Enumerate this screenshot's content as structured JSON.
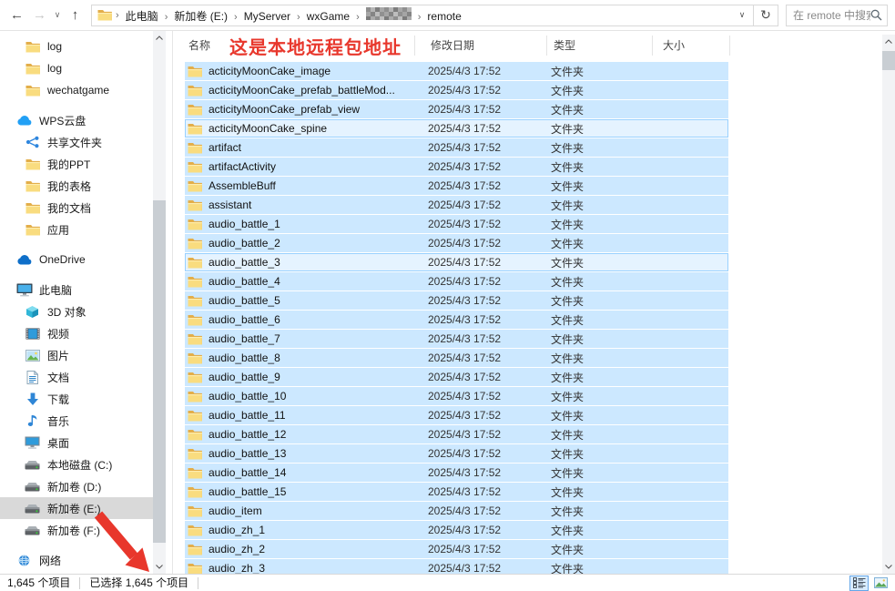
{
  "colors": {
    "selection_blue": "#cce8ff",
    "focus_row_bg": "#e5f3ff",
    "focus_row_border": "#99d1ff",
    "sidebar_selected": "#d9d9d9",
    "annotation_red": "#e8372c",
    "folder_yellow": "#f9dc7f",
    "accent_blue": "#0078d7"
  },
  "toolbar": {
    "back_glyph": "←",
    "forward_glyph": "→",
    "history_chevron_glyph": "∨",
    "up_glyph": "↑",
    "address_chevron_glyph": "∨",
    "refresh_glyph": "↻"
  },
  "address_bar": {
    "crumbs": [
      {
        "label": "此电脑",
        "redacted": false
      },
      {
        "label": "新加卷 (E:)",
        "redacted": false
      },
      {
        "label": "MyServer",
        "redacted": false
      },
      {
        "label": "wxGame",
        "redacted": false
      },
      {
        "label": "",
        "redacted": true
      },
      {
        "label": "remote",
        "redacted": false
      }
    ],
    "separator_glyph": "›"
  },
  "search": {
    "placeholder": "在 remote 中搜索"
  },
  "annotation": {
    "text": "这是本地远程包地址"
  },
  "sidebar": {
    "items": [
      {
        "label": "log",
        "icon": "folder",
        "level": 1,
        "gap_before": false,
        "selected": false
      },
      {
        "label": "log",
        "icon": "folder",
        "level": 1,
        "gap_before": false,
        "selected": false
      },
      {
        "label": "wechatgame",
        "icon": "folder",
        "level": 1,
        "gap_before": false,
        "selected": false
      },
      {
        "label": "WPS云盘",
        "icon": "wps-cloud",
        "level": 0,
        "gap_before": true,
        "selected": false
      },
      {
        "label": "共享文件夹",
        "icon": "share",
        "level": 1,
        "gap_before": false,
        "selected": false
      },
      {
        "label": "我的PPT",
        "icon": "folder",
        "level": 1,
        "gap_before": false,
        "selected": false
      },
      {
        "label": "我的表格",
        "icon": "folder",
        "level": 1,
        "gap_before": false,
        "selected": false
      },
      {
        "label": "我的文档",
        "icon": "folder",
        "level": 1,
        "gap_before": false,
        "selected": false
      },
      {
        "label": "应用",
        "icon": "folder",
        "level": 1,
        "gap_before": false,
        "selected": false
      },
      {
        "label": "OneDrive",
        "icon": "onedrive-cloud",
        "level": 0,
        "gap_before": true,
        "selected": false
      },
      {
        "label": "此电脑",
        "icon": "this-pc",
        "level": 0,
        "gap_before": true,
        "selected": false
      },
      {
        "label": "3D 对象",
        "icon": "3d-object",
        "level": 1,
        "gap_before": false,
        "selected": false
      },
      {
        "label": "视频",
        "icon": "video",
        "level": 1,
        "gap_before": false,
        "selected": false
      },
      {
        "label": "图片",
        "icon": "pictures",
        "level": 1,
        "gap_before": false,
        "selected": false
      },
      {
        "label": "文档",
        "icon": "documents",
        "level": 1,
        "gap_before": false,
        "selected": false
      },
      {
        "label": "下载",
        "icon": "downloads",
        "level": 1,
        "gap_before": false,
        "selected": false
      },
      {
        "label": "音乐",
        "icon": "music",
        "level": 1,
        "gap_before": false,
        "selected": false
      },
      {
        "label": "桌面",
        "icon": "desktop",
        "level": 1,
        "gap_before": false,
        "selected": false
      },
      {
        "label": "本地磁盘 (C:)",
        "icon": "drive",
        "level": 1,
        "gap_before": false,
        "selected": false
      },
      {
        "label": "新加卷 (D:)",
        "icon": "drive",
        "level": 1,
        "gap_before": false,
        "selected": false
      },
      {
        "label": "新加卷 (E:)",
        "icon": "drive",
        "level": 1,
        "gap_before": false,
        "selected": true
      },
      {
        "label": "新加卷 (F:)",
        "icon": "drive",
        "level": 1,
        "gap_before": false,
        "selected": false
      },
      {
        "label": "网络",
        "icon": "network",
        "level": 0,
        "gap_before": true,
        "selected": false
      }
    ]
  },
  "file_list": {
    "columns": [
      "名称",
      "修改日期",
      "类型",
      "大小"
    ],
    "rows": [
      {
        "name": "acticityMoonCake_image",
        "date": "2025/4/3 17:52",
        "type": "文件夹",
        "size": "",
        "focused": false
      },
      {
        "name": "acticityMoonCake_prefab_battleMod...",
        "date": "2025/4/3 17:52",
        "type": "文件夹",
        "size": "",
        "focused": false
      },
      {
        "name": "acticityMoonCake_prefab_view",
        "date": "2025/4/3 17:52",
        "type": "文件夹",
        "size": "",
        "focused": false
      },
      {
        "name": "acticityMoonCake_spine",
        "date": "2025/4/3 17:52",
        "type": "文件夹",
        "size": "",
        "focused": true
      },
      {
        "name": "artifact",
        "date": "2025/4/3 17:52",
        "type": "文件夹",
        "size": "",
        "focused": false
      },
      {
        "name": "artifactActivity",
        "date": "2025/4/3 17:52",
        "type": "文件夹",
        "size": "",
        "focused": false
      },
      {
        "name": "AssembleBuff",
        "date": "2025/4/3 17:52",
        "type": "文件夹",
        "size": "",
        "focused": false
      },
      {
        "name": "assistant",
        "date": "2025/4/3 17:52",
        "type": "文件夹",
        "size": "",
        "focused": false
      },
      {
        "name": "audio_battle_1",
        "date": "2025/4/3 17:52",
        "type": "文件夹",
        "size": "",
        "focused": false
      },
      {
        "name": "audio_battle_2",
        "date": "2025/4/3 17:52",
        "type": "文件夹",
        "size": "",
        "focused": false
      },
      {
        "name": "audio_battle_3",
        "date": "2025/4/3 17:52",
        "type": "文件夹",
        "size": "",
        "focused": true
      },
      {
        "name": "audio_battle_4",
        "date": "2025/4/3 17:52",
        "type": "文件夹",
        "size": "",
        "focused": false
      },
      {
        "name": "audio_battle_5",
        "date": "2025/4/3 17:52",
        "type": "文件夹",
        "size": "",
        "focused": false
      },
      {
        "name": "audio_battle_6",
        "date": "2025/4/3 17:52",
        "type": "文件夹",
        "size": "",
        "focused": false
      },
      {
        "name": "audio_battle_7",
        "date": "2025/4/3 17:52",
        "type": "文件夹",
        "size": "",
        "focused": false
      },
      {
        "name": "audio_battle_8",
        "date": "2025/4/3 17:52",
        "type": "文件夹",
        "size": "",
        "focused": false
      },
      {
        "name": "audio_battle_9",
        "date": "2025/4/3 17:52",
        "type": "文件夹",
        "size": "",
        "focused": false
      },
      {
        "name": "audio_battle_10",
        "date": "2025/4/3 17:52",
        "type": "文件夹",
        "size": "",
        "focused": false
      },
      {
        "name": "audio_battle_11",
        "date": "2025/4/3 17:52",
        "type": "文件夹",
        "size": "",
        "focused": false
      },
      {
        "name": "audio_battle_12",
        "date": "2025/4/3 17:52",
        "type": "文件夹",
        "size": "",
        "focused": false
      },
      {
        "name": "audio_battle_13",
        "date": "2025/4/3 17:52",
        "type": "文件夹",
        "size": "",
        "focused": false
      },
      {
        "name": "audio_battle_14",
        "date": "2025/4/3 17:52",
        "type": "文件夹",
        "size": "",
        "focused": false
      },
      {
        "name": "audio_battle_15",
        "date": "2025/4/3 17:52",
        "type": "文件夹",
        "size": "",
        "focused": false
      },
      {
        "name": "audio_item",
        "date": "2025/4/3 17:52",
        "type": "文件夹",
        "size": "",
        "focused": false
      },
      {
        "name": "audio_zh_1",
        "date": "2025/4/3 17:52",
        "type": "文件夹",
        "size": "",
        "focused": false
      },
      {
        "name": "audio_zh_2",
        "date": "2025/4/3 17:52",
        "type": "文件夹",
        "size": "",
        "focused": false
      },
      {
        "name": "audio_zh_3",
        "date": "2025/4/3 17:52",
        "type": "文件夹",
        "size": "",
        "focused": false
      }
    ]
  },
  "status_bar": {
    "items_count": "1,645 个项目",
    "selection_count": "已选择 1,645 个项目"
  }
}
